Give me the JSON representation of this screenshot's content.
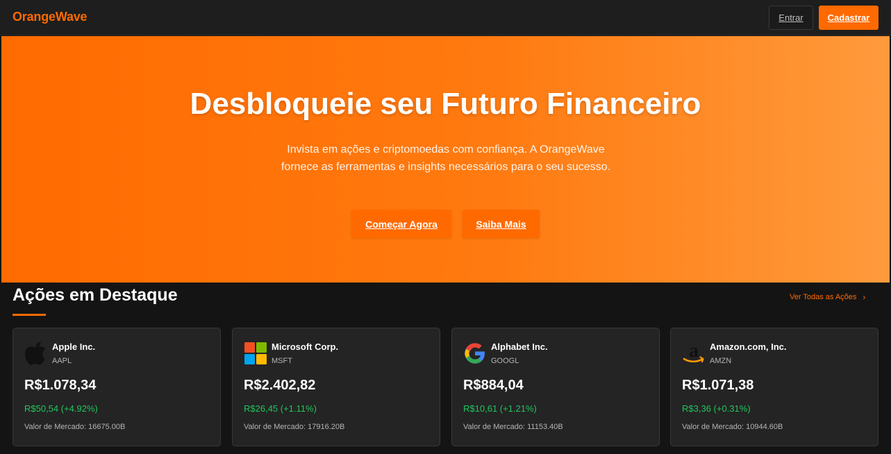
{
  "header": {
    "logo": "OrangeWave",
    "login_label": "Entrar",
    "signup_label": "Cadastrar"
  },
  "hero": {
    "title": "Desbloqueie seu Futuro Financeiro",
    "subtitle": "Invista em ações e criptomoedas com confiança. A OrangeWave fornece as ferramentas e insights necessários para o seu sucesso.",
    "primary_button": "Começar Agora",
    "secondary_button": "Saiba Mais"
  },
  "featured": {
    "title": "Ações em Destaque",
    "see_all_label": "Ver Todas as Ações",
    "see_all_icon": "chevron-right-icon",
    "stocks": [
      {
        "name": "Apple Inc.",
        "ticker": "AAPL",
        "price": "R$1.078,34",
        "change": "R$50,54 (+4.92%)",
        "market_cap": "Valor de Mercado: 16675.00B",
        "icon": "apple-logo-icon"
      },
      {
        "name": "Microsoft Corp.",
        "ticker": "MSFT",
        "price": "R$2.402,82",
        "change": "R$26,45 (+1.11%)",
        "market_cap": "Valor de Mercado: 17916.20B",
        "icon": "microsoft-logo-icon"
      },
      {
        "name": "Alphabet Inc.",
        "ticker": "GOOGL",
        "price": "R$884,04",
        "change": "R$10,61 (+1.21%)",
        "market_cap": "Valor de Mercado: 11153.40B",
        "icon": "google-logo-icon"
      },
      {
        "name": "Amazon.com, Inc.",
        "ticker": "AMZN",
        "price": "R$1.071,38",
        "change": "R$3,36 (+0.31%)",
        "market_cap": "Valor de Mercado: 10944.60B",
        "icon": "amazon-logo-icon"
      }
    ]
  },
  "colors": {
    "accent": "#ff6a00",
    "positive": "#22c55e",
    "background": "#141414",
    "card": "#242424"
  }
}
